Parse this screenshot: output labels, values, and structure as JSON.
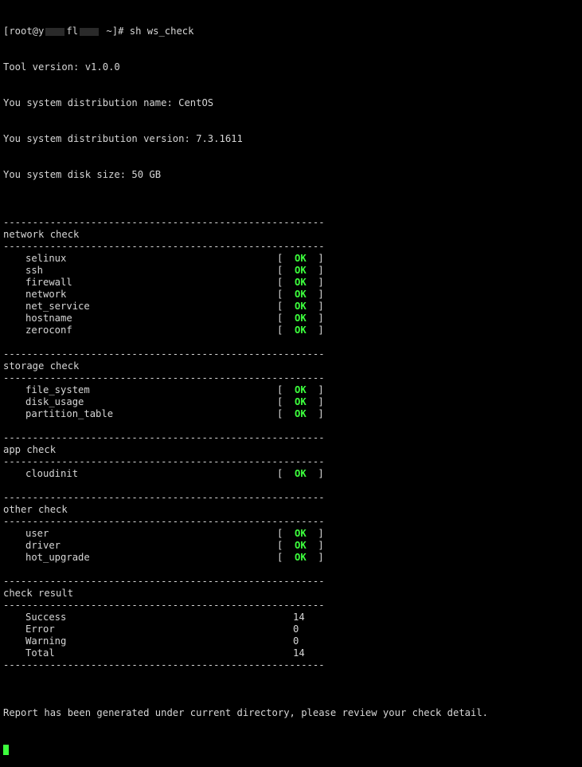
{
  "prompt": {
    "user_host_start": "[root@y",
    "host_mid": "fl",
    "host_end": " ~]#",
    "command": " sh ws_check"
  },
  "info": [
    "Tool version: v1.0.0",
    "You system distribution name: CentOS",
    "You system distribution version: 7.3.1611",
    "You system disk size: 50 GB"
  ],
  "separator": "------------------------------------------------------------",
  "status_open": "[  ",
  "status_close": "  ]",
  "sections": [
    {
      "title": "network check",
      "items": [
        {
          "name": "selinux",
          "status": "OK"
        },
        {
          "name": "ssh",
          "status": "OK"
        },
        {
          "name": "firewall",
          "status": "OK"
        },
        {
          "name": "network",
          "status": "OK"
        },
        {
          "name": "net_service",
          "status": "OK"
        },
        {
          "name": "hostname",
          "status": "OK"
        },
        {
          "name": "zeroconf",
          "status": "OK"
        }
      ]
    },
    {
      "title": "storage check",
      "items": [
        {
          "name": "file_system",
          "status": "OK"
        },
        {
          "name": "disk_usage",
          "status": "OK"
        },
        {
          "name": "partition_table",
          "status": "OK"
        }
      ]
    },
    {
      "title": "app check",
      "items": [
        {
          "name": "cloudinit",
          "status": "OK"
        }
      ]
    },
    {
      "title": "other check",
      "items": [
        {
          "name": "user",
          "status": "OK"
        },
        {
          "name": "driver",
          "status": "OK"
        },
        {
          "name": "hot_upgrade",
          "status": "OK"
        }
      ]
    }
  ],
  "result": {
    "title": "check result",
    "rows": [
      {
        "name": "Success",
        "value": "14"
      },
      {
        "name": "Error",
        "value": "0"
      },
      {
        "name": "Warning",
        "value": "0"
      },
      {
        "name": "Total",
        "value": "14"
      }
    ]
  },
  "footer": "Report has been generated under current directory, please review your check detail.",
  "colors": {
    "background": "#000000",
    "text": "#d6d6d6",
    "ok": "#3dff3d"
  }
}
